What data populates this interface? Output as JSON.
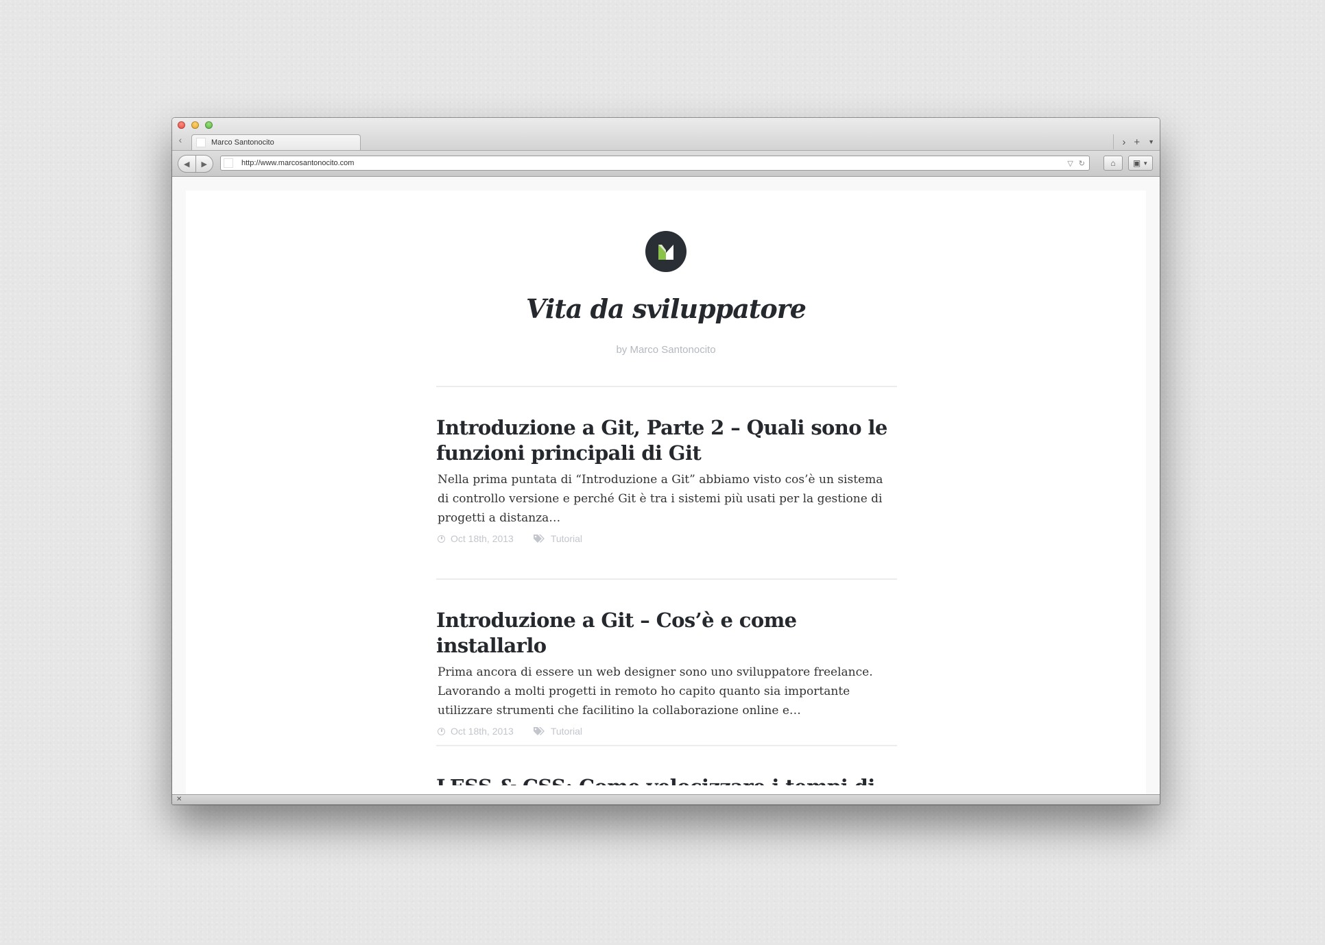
{
  "browser": {
    "tab": {
      "title": "Marco Santonocito"
    },
    "url": "http://www.marcosantonocito.com"
  },
  "site": {
    "title": "Vita da sviluppatore",
    "byline": "by Marco Santonocito",
    "logo_colors": {
      "circle": "#2a2e35",
      "accent": "#8bc34a",
      "light": "#ffffff"
    }
  },
  "posts": [
    {
      "title": "Introduzione a Git, Parte 2 – Quali sono le funzioni principali di Git",
      "excerpt": "Nella prima puntata di “Introduzione a Git” abbiamo visto cos’è un sistema di controllo versione e perché Git è tra i sistemi più usati per la gestione di progetti a distanza…",
      "date": "Oct 18th, 2013",
      "category": "Tutorial"
    },
    {
      "title": "Introduzione a Git – Cos’è e come installarlo",
      "excerpt": "Prima ancora di essere un web designer sono uno sviluppatore freelance. Lavorando a molti progetti in remoto ho capito quanto sia importante utilizzare strumenti che facilitino la collaborazione online e…",
      "date": "Oct 18th, 2013",
      "category": "Tutorial"
    },
    {
      "title": "LESS & CSS: Come velocizzare i tempi di"
    }
  ],
  "colors": {
    "heading": "#25282d",
    "meta": "#c2c6cc",
    "byline": "#b4b8bf"
  }
}
